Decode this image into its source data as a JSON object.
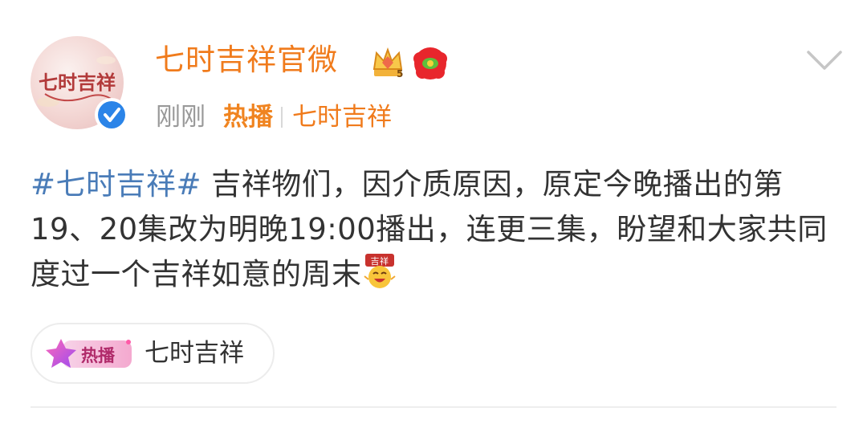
{
  "post": {
    "user": {
      "name": "七时吉祥官微",
      "avatar_text": "七时吉祥",
      "badges": [
        "crown-badge-icon",
        "red-flower-badge-icon"
      ],
      "verified": true
    },
    "meta": {
      "time": "刚刚",
      "hot_label": "热播",
      "source": "七时吉祥"
    },
    "content": {
      "hashtag": "#七时吉祥#",
      "text": " 吉祥物们，因介质原因，原定今晚播出的第19、20集改为明晚19:00播出，连更三集，盼望和大家共同度过一个吉祥如意的周末",
      "emoji_label": "吉祥"
    },
    "tag_chip": {
      "logo_label": "热播",
      "label": "七时吉祥"
    }
  },
  "colors": {
    "username": "#f07b1c",
    "hashtag": "#4a7cb8",
    "meta_gray": "#999999",
    "text": "#333333",
    "verified_blue": "#2b84e8"
  },
  "icons": {
    "more": "chevron-down-icon",
    "verified": "verified-badge-icon"
  }
}
